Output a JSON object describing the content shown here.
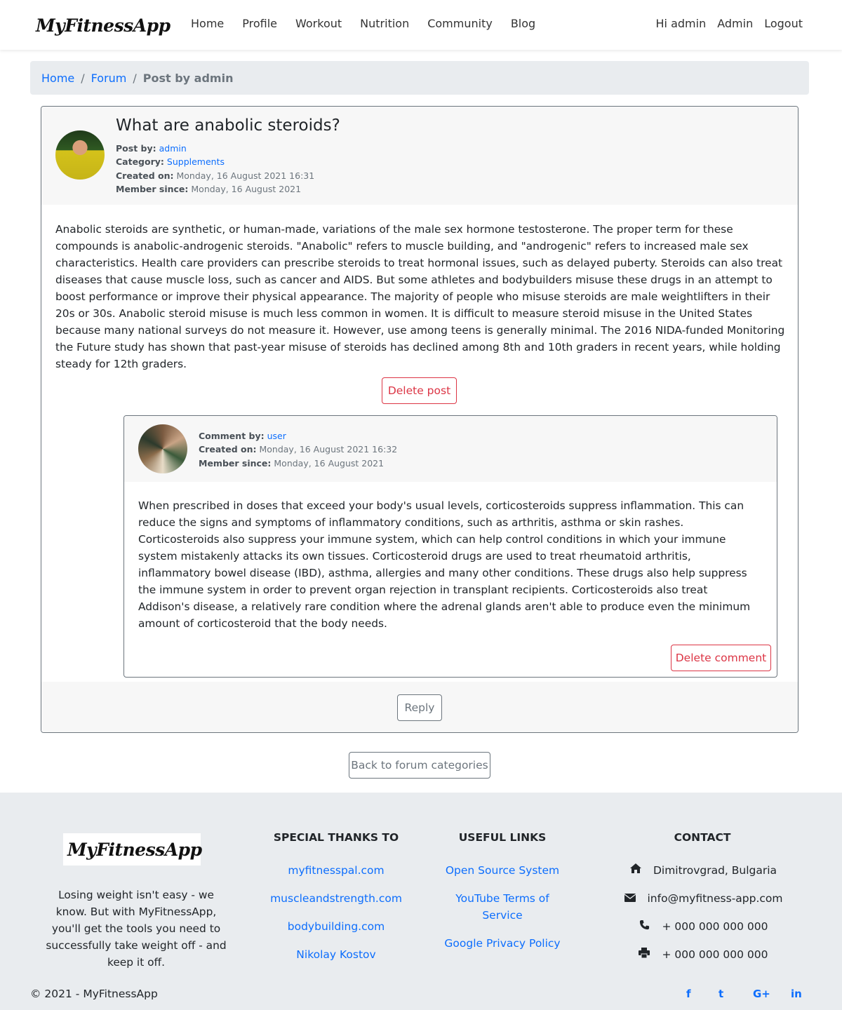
{
  "brand": {
    "name": "MyFitnessApp"
  },
  "nav": {
    "left": [
      "Home",
      "Profile",
      "Workout",
      "Nutrition",
      "Community",
      "Blog"
    ],
    "right": [
      "Hi admin",
      "Admin",
      "Logout"
    ]
  },
  "breadcrumb": {
    "home": "Home",
    "sep1": "/",
    "forum": "Forum",
    "sep2": "/",
    "current": "Post by admin"
  },
  "post": {
    "title": "What are anabolic steroids?",
    "post_by_label": "Post by:",
    "post_by": "admin",
    "category_label": "Category:",
    "category": "Supplements",
    "created_label": "Created on:",
    "created": "Monday, 16 August 2021 16:31",
    "member_label": "Member since:",
    "member": "Monday, 16 August 2021",
    "body": "Anabolic steroids are synthetic, or human-made, variations of the male sex hormone testosterone. The proper term for these compounds is anabolic-androgenic steroids. \"Anabolic\" refers to muscle building, and \"androgenic\" refers to increased male sex characteristics. Health care providers can prescribe steroids to treat hormonal issues, such as delayed puberty. Steroids can also treat diseases that cause muscle loss, such as cancer and AIDS. But some athletes and bodybuilders misuse these drugs in an attempt to boost performance or improve their physical appearance. The majority of people who misuse steroids are male weightlifters in their 20s or 30s. Anabolic steroid misuse is much less common in women. It is difficult to measure steroid misuse in the United States because many national surveys do not measure it. However, use among teens is generally minimal. The 2016 NIDA-funded Monitoring the Future study has shown that past-year misuse of steroids has declined among 8th and 10th graders in recent years, while holding steady for 12th graders.",
    "delete_label": "Delete post",
    "reply_label": "Reply"
  },
  "comment": {
    "by_label": "Comment by:",
    "by": "user",
    "created_label": "Created on:",
    "created": "Monday, 16 August 2021 16:32",
    "member_label": "Member since:",
    "member": "Monday, 16 August 2021",
    "body": "When prescribed in doses that exceed your body's usual levels, corticosteroids suppress inflammation. This can reduce the signs and symptoms of inflammatory conditions, such as arthritis, asthma or skin rashes. Corticosteroids also suppress your immune system, which can help control conditions in which your immune system mistakenly attacks its own tissues. Corticosteroid drugs are used to treat rheumatoid arthritis, inflammatory bowel disease (IBD), asthma, allergies and many other conditions. These drugs also help suppress the immune system in order to prevent organ rejection in transplant recipients. Corticosteroids also treat Addison's disease, a relatively rare condition where the adrenal glands aren't able to produce even the minimum amount of corticosteroid that the body needs.",
    "delete_label": "Delete comment"
  },
  "back_label": "Back to forum categories",
  "footer": {
    "about": "Losing weight isn't easy - we know. But with MyFitnessApp, you'll get the tools you need to successfully take weight off - and keep it off.",
    "thanks_title": "SPECIAL THANKS TO",
    "thanks": [
      "myfitnesspal.com",
      "muscleandstrength.com",
      "bodybuilding.com",
      "Nikolay Kostov"
    ],
    "links_title": "USEFUL LINKS",
    "links": [
      "Open Source System",
      "YouTube Terms of Service",
      "Google Privacy Policy"
    ],
    "contact_title": "CONTACT",
    "contact": {
      "address": "Dimitrovgrad, Bulgaria",
      "email": "info@myfitness-app.com",
      "phone": "+ 000 000 000 000",
      "fax": "+ 000 000 000 000"
    },
    "copyright": "© 2021 - MyFitnessApp",
    "social": [
      "f",
      "t",
      "G+",
      "in"
    ]
  },
  "icons": {
    "home": "home-icon",
    "email": "envelope-icon",
    "phone": "phone-icon",
    "fax": "print-icon"
  },
  "colors": {
    "link": "#0d6efd",
    "danger": "#dc3545",
    "secondary": "#6c757d"
  }
}
